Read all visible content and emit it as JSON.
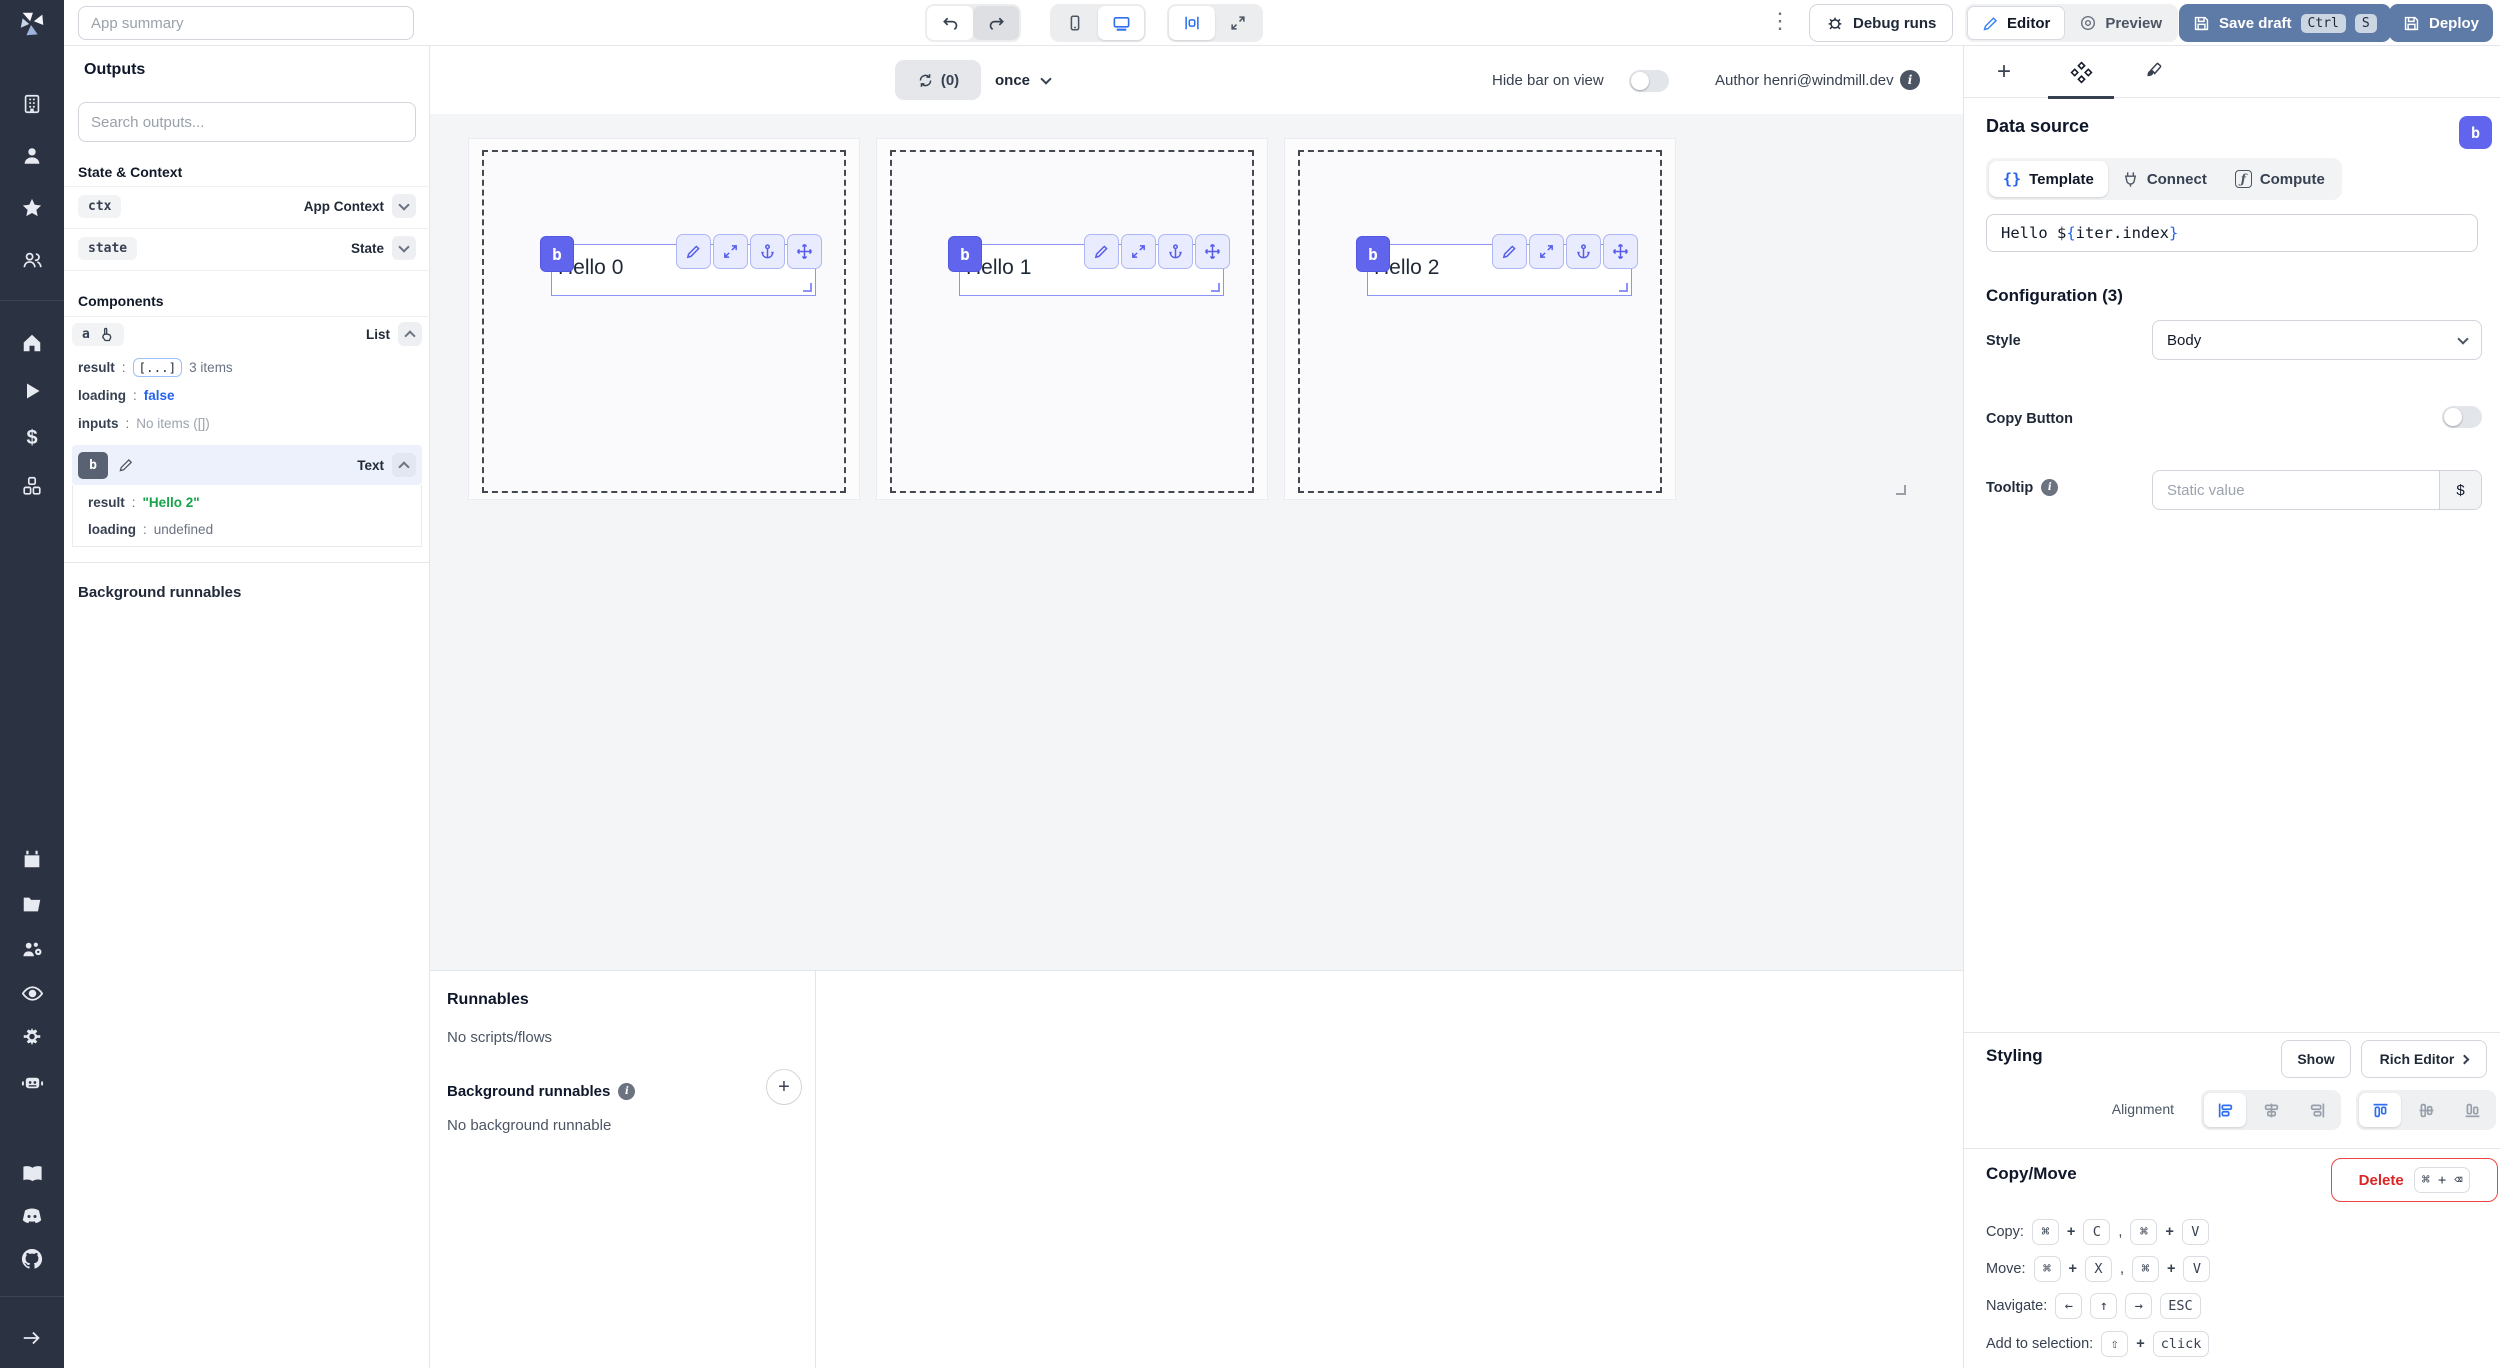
{
  "icons": {
    "menu_dots": "⋮",
    "tab_plus": "+",
    "runnable_plus": "+",
    "info": "i",
    "dollar": "$",
    "braces": "{}",
    "fn": "ƒ",
    "rich_editor_chevron": "›"
  },
  "topbar": {
    "app_summary_placeholder": "App summary",
    "debug_runs_label": "Debug runs",
    "editor_label": "Editor",
    "preview_label": "Preview",
    "save_draft_label": "Save draft",
    "save_draft_kbd_1": "Ctrl",
    "save_draft_kbd_2": "S",
    "deploy_label": "Deploy"
  },
  "sidebar": {
    "icons": [
      "windmill-logo",
      "building",
      "user",
      "star",
      "users",
      "home",
      "play",
      "dollar",
      "boxes",
      "calendar",
      "folder",
      "user-group-gear",
      "eye",
      "gear",
      "robot",
      "book",
      "discord",
      "github",
      "arrow-right"
    ]
  },
  "outputs": {
    "title": "Outputs",
    "search_placeholder": "Search outputs...",
    "state_context_title": "State & Context",
    "ctx_key": "ctx",
    "ctx_type": "App Context",
    "state_key": "state",
    "state_type": "State",
    "components_title": "Components",
    "colon": ":",
    "comp_a": {
      "id": "a",
      "type": "List",
      "result_key": "result",
      "result_badge": "[...]",
      "result_note": "3 items",
      "loading_key": "loading",
      "loading_value": "false",
      "inputs_key": "inputs",
      "inputs_value": "No items ([])"
    },
    "comp_b": {
      "id": "b",
      "type": "Text",
      "result_key": "result",
      "result_value": "\"Hello 2\"",
      "loading_key": "loading",
      "loading_value": "undefined"
    },
    "background_runnables_title": "Background runnables"
  },
  "canvas": {
    "refresh_count": "(0)",
    "frequency": "once",
    "hide_bar_label": "Hide bar on view",
    "author_label": "Author henri@windmill.dev",
    "badge": "b",
    "items": [
      {
        "label": "Hello 0"
      },
      {
        "label": "Hello 1"
      },
      {
        "label": "Hello 2"
      }
    ]
  },
  "runnables": {
    "title": "Runnables",
    "empty": "No scripts/flows",
    "background_title": "Background runnables",
    "background_empty": "No background runnable"
  },
  "panel": {
    "data_source_title": "Data source",
    "badge": "b",
    "tab_template": "Template",
    "tab_connect": "Connect",
    "tab_compute": "Compute",
    "code_prefix": "Hello $",
    "code_open": "{",
    "code_expr": "iter.index",
    "code_close": "}",
    "configuration_title": "Configuration (3)",
    "style_label": "Style",
    "style_value": "Body",
    "copy_button_label": "Copy Button",
    "tooltip_label": "Tooltip",
    "tooltip_placeholder": "Static value",
    "tooltip_suffix": "$",
    "styling_title": "Styling",
    "show_label": "Show",
    "rich_editor_label": "Rich Editor",
    "alignment_label": "Alignment",
    "copy_move_title": "Copy/Move",
    "delete_label": "Delete",
    "delete_kbd": "⌘ + ⌫",
    "copy_label": "Copy:",
    "move_label": "Move:",
    "navigate_label": "Navigate:",
    "selection_label": "Add to selection:",
    "kbd_cmd": "⌘",
    "kbd_c": "C",
    "kbd_v": "V",
    "kbd_x": "X",
    "kbd_left": "←",
    "kbd_up": "↑",
    "kbd_right": "→",
    "kbd_esc": "ESC",
    "kbd_shift": "⇧",
    "kbd_click": "click",
    "plus": "+",
    "comma": ","
  }
}
